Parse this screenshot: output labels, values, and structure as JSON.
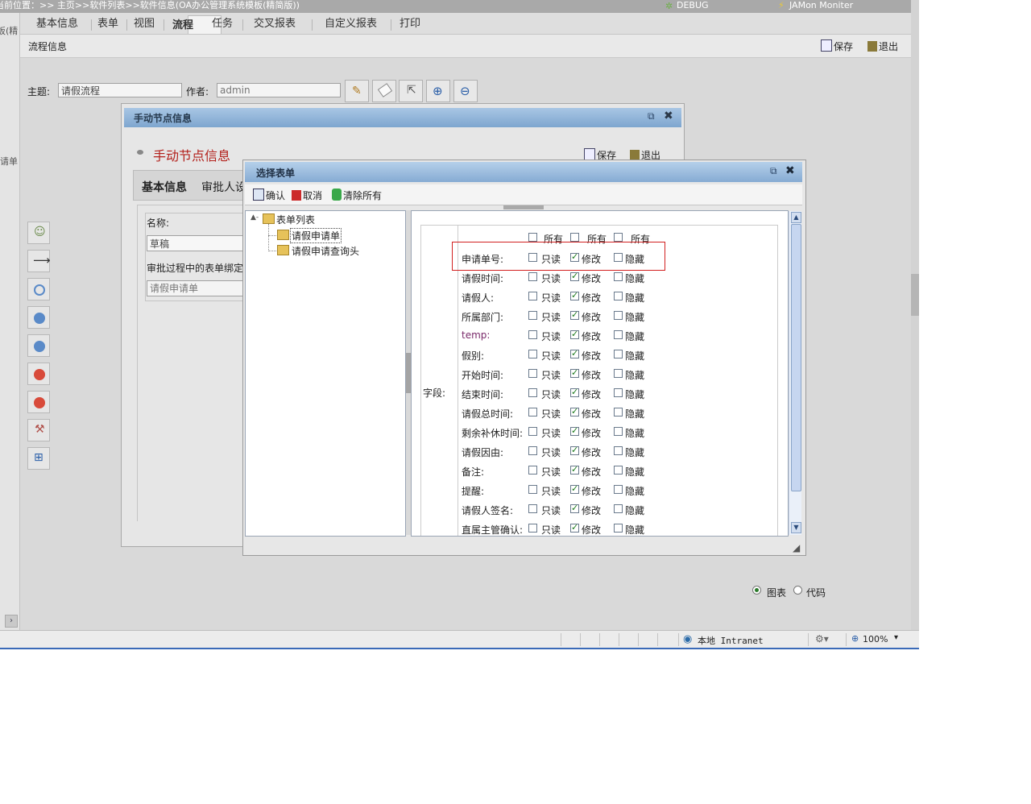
{
  "topbar": {
    "location": "当前位置：>> 主页>>软件列表>>软件信息(OA办公管理系统模板(精简版))",
    "debug": "DEBUG",
    "jamon": "JAMon Moniter"
  },
  "left_cut": {
    "top": "板(精",
    "mid": "请单"
  },
  "tabs": [
    "基本信息",
    "表单",
    "视图",
    "流程",
    "任务",
    "交叉报表",
    "自定义报表",
    "打印"
  ],
  "active_tab": "流程",
  "infobar": {
    "title": "流程信息",
    "save": "保存",
    "exit": "退出"
  },
  "form": {
    "subject_label": "主题:",
    "subject_value": "请假流程",
    "author_label": "作者:",
    "author_placeholder": "admin"
  },
  "win1": {
    "title": "手动节点信息",
    "heading": "手动节点信息",
    "save": "保存",
    "exit": "退出",
    "tabs": [
      "基本信息",
      "审批人设"
    ],
    "name_label": "名称:",
    "name_value": "草稿",
    "bind_label": "审批过程中的表单绑定",
    "bind_placeholder": "请假申请单"
  },
  "win2": {
    "title": "选择表单",
    "toolbar": {
      "confirm": "确认",
      "cancel": "取消",
      "clear": "清除所有"
    },
    "tree": {
      "root": "表单列表",
      "children": [
        "请假申请单",
        "请假申请查询头"
      ]
    },
    "field_section_label": "字段:",
    "all_label": "所有",
    "options": [
      "只读",
      "修改",
      "隐藏"
    ],
    "rows": [
      {
        "name": "申请单号:",
        "readonly": false,
        "modify": true,
        "hide": false
      },
      {
        "name": "请假时间:",
        "readonly": false,
        "modify": true,
        "hide": false
      },
      {
        "name": "请假人:",
        "readonly": false,
        "modify": true,
        "hide": false
      },
      {
        "name": "所属部门:",
        "readonly": false,
        "modify": true,
        "hide": false
      },
      {
        "name": "temp:",
        "readonly": false,
        "modify": true,
        "hide": false
      },
      {
        "name": "假别:",
        "readonly": false,
        "modify": true,
        "hide": false
      },
      {
        "name": "开始时间:",
        "readonly": false,
        "modify": true,
        "hide": false
      },
      {
        "name": "结束时间:",
        "readonly": false,
        "modify": true,
        "hide": false
      },
      {
        "name": "请假总时间:",
        "readonly": false,
        "modify": true,
        "hide": false
      },
      {
        "name": "剩余补休时间:",
        "readonly": false,
        "modify": true,
        "hide": false
      },
      {
        "name": "请假因由:",
        "readonly": false,
        "modify": true,
        "hide": false
      },
      {
        "name": "备注:",
        "readonly": false,
        "modify": true,
        "hide": false
      },
      {
        "name": "提醒:",
        "readonly": false,
        "modify": true,
        "hide": false
      },
      {
        "name": "请假人签名:",
        "readonly": false,
        "modify": true,
        "hide": false
      },
      {
        "name": "直属主管确认:",
        "readonly": false,
        "modify": true,
        "hide": false
      }
    ]
  },
  "view_toggle": {
    "chart": "图表",
    "code": "代码",
    "selected": "图表"
  },
  "statusbar": {
    "zone": "本地 Intranet",
    "zoom": "100%"
  },
  "colors": {
    "title_blue": "#7ea6cf",
    "highlight_red": "#d22020",
    "heading_red": "#b3201b"
  }
}
